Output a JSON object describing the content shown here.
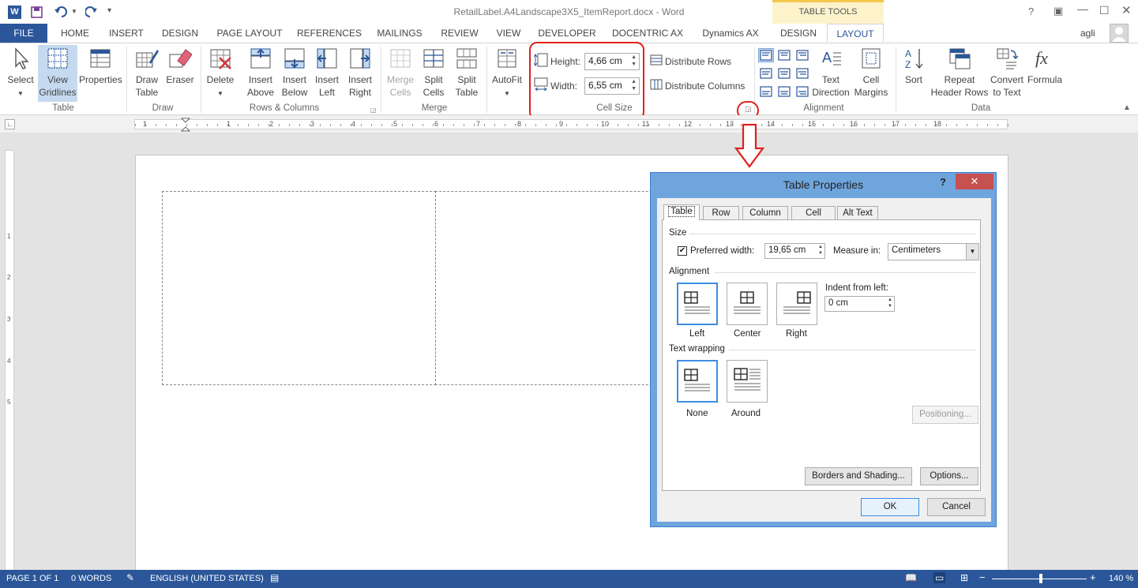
{
  "window": {
    "title": "RetailLabel.A4Landscape3X5_ItemReport.docx - Word",
    "user": "agli"
  },
  "tabs": [
    "FILE",
    "HOME",
    "INSERT",
    "DESIGN",
    "PAGE LAYOUT",
    "REFERENCES",
    "MAILINGS",
    "REVIEW",
    "VIEW",
    "DEVELOPER",
    "DOCENTRIC AX",
    "Dynamics AX",
    "DESIGN",
    "LAYOUT"
  ],
  "context_tab_group": "TABLE TOOLS",
  "ribbon": {
    "select": "Select",
    "view": "View",
    "gridlines": "Gridlines",
    "properties": "Properties",
    "group_table": "Table",
    "draw": "Draw",
    "table": "Table",
    "eraser": "Eraser",
    "group_draw": "Draw",
    "delete": "Delete",
    "insert": "Insert",
    "above": "Above",
    "below": "Below",
    "left": "Left",
    "right": "Right",
    "group_rows": "Rows & Columns",
    "merge": "Merge",
    "cells": "Cells",
    "split": "Split",
    "split_table": "Table",
    "group_merge": "Merge",
    "autofit": "AutoFit",
    "height_label": "Height:",
    "height_value": "4,66 cm",
    "width_label": "Width:",
    "width_value": "6,55 cm",
    "distribute_rows": "Distribute Rows",
    "distribute_columns": "Distribute Columns",
    "group_cellsize": "Cell Size",
    "text": "Text",
    "direction": "Direction",
    "cell": "Cell",
    "margins": "Margins",
    "group_alignment": "Alignment",
    "sort": "Sort",
    "repeat": "Repeat",
    "header_rows": "Header Rows",
    "convert": "Convert",
    "to_text": "to Text",
    "formula": "Formula",
    "group_data": "Data"
  },
  "ruler": [
    "1",
    "1",
    "2",
    "3",
    "4",
    "5",
    "6",
    "7",
    "8",
    "9",
    "10",
    "11",
    "12",
    "13",
    "14",
    "15",
    "16",
    "17",
    "18"
  ],
  "vruler": [
    "1",
    "2",
    "3",
    "4",
    "5"
  ],
  "dialog": {
    "title": "Table Properties",
    "help": "?",
    "tabs": [
      "Table",
      "Row",
      "Column",
      "Cell",
      "Alt Text"
    ],
    "size_label": "Size",
    "preferred_width": "Preferred width:",
    "preferred_width_value": "19,65 cm",
    "measure_in": "Measure in:",
    "measure_value": "Centimeters",
    "alignment_label": "Alignment",
    "align_left": "Left",
    "align_center": "Center",
    "align_right": "Right",
    "indent_label": "Indent from left:",
    "indent_value": "0 cm",
    "wrapping_label": "Text wrapping",
    "wrap_none": "None",
    "wrap_around": "Around",
    "positioning": "Positioning...",
    "borders": "Borders and Shading...",
    "options": "Options...",
    "ok": "OK",
    "cancel": "Cancel"
  },
  "status": {
    "page": "PAGE 1 OF 1",
    "words": "0 WORDS",
    "language": "ENGLISH (UNITED STATES)",
    "zoom": "140 %"
  }
}
